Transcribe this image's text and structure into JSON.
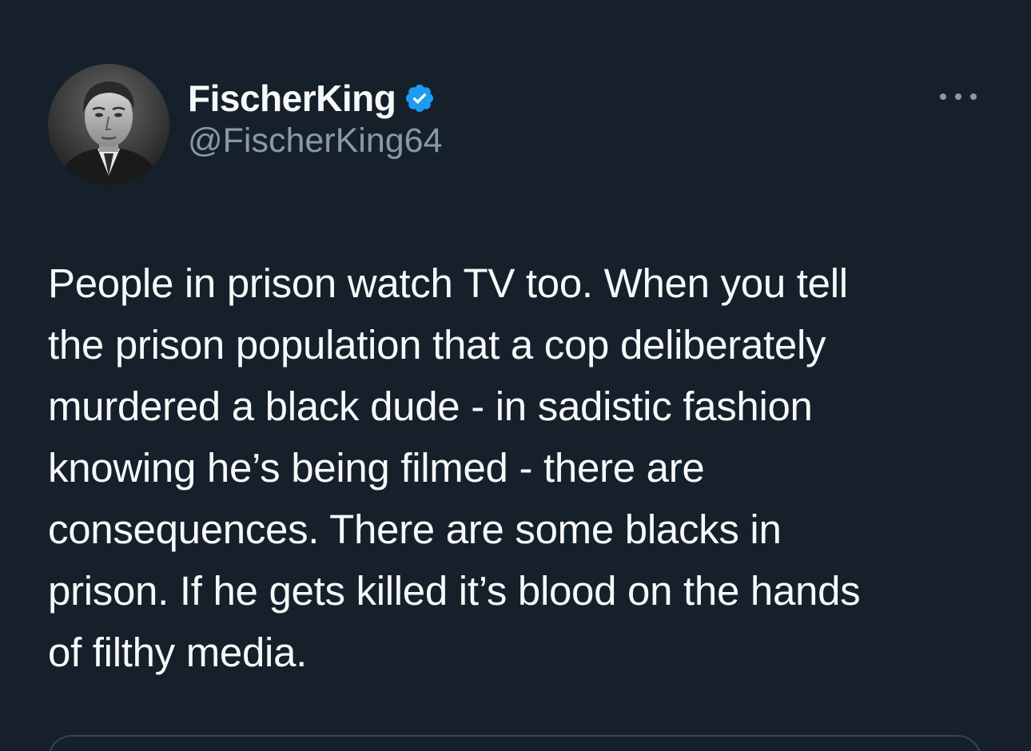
{
  "author": {
    "display_name": "FischerKing",
    "handle": "@FischerKing64",
    "verified": true,
    "avatar_icon": "profile-photo"
  },
  "tweet": {
    "text": "People in prison watch TV too. When you tell\nthe prison population that a cop deliberately\nmurdered a black dude - in sadistic fashion\nknowing he’s being filmed - there are\nconsequences. There are some blacks in\nprison. If he gets killed it’s blood on the hands\nof filthy media."
  },
  "icons": {
    "verified": "verified-badge-icon",
    "more": "more-options-icon"
  },
  "colors": {
    "background": "#15202b",
    "text": "#f7f9f9",
    "secondary_text": "#8b98a5",
    "verified_blue": "#1d9bf0",
    "border": "#38444d"
  }
}
